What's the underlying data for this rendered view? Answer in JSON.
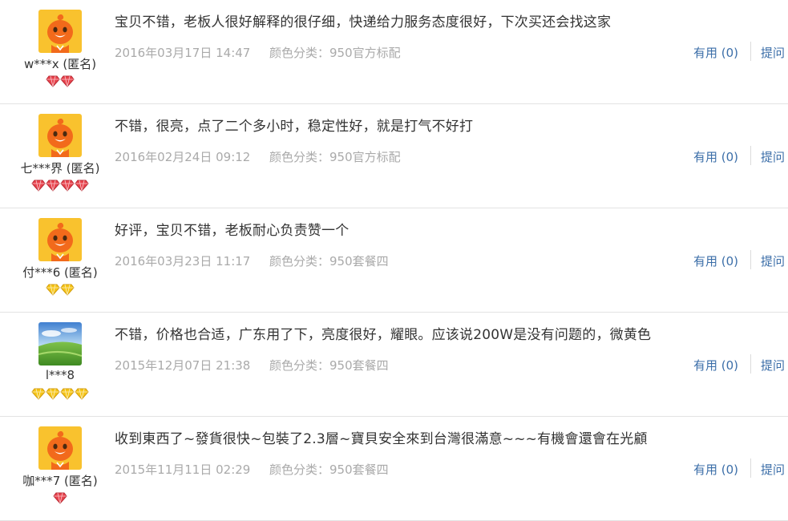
{
  "reviews": [
    {
      "nickname": "w***x (匿名)",
      "avatar": "mascot-icon",
      "badge_type": "red-diamond",
      "badge_count": 2,
      "content": "宝贝不错，老板人很好解释的很仔细，快递给力服务态度很好，下次买还会找这家",
      "date": "2016年03月17日 14:47",
      "sku": "颜色分类：950官方标配",
      "useful": "有用 (0)",
      "reply": "提问"
    },
    {
      "nickname": "七***界 (匿名)",
      "avatar": "mascot-icon",
      "badge_type": "red-diamond",
      "badge_count": 4,
      "content": "不错，很亮，点了二个多小时，稳定性好，就是打气不好打",
      "date": "2016年02月24日 09:12",
      "sku": "颜色分类：950官方标配",
      "useful": "有用 (0)",
      "reply": "提问"
    },
    {
      "nickname": "付***6 (匿名)",
      "avatar": "mascot-icon",
      "badge_type": "yellow-diamond",
      "badge_count": 2,
      "content": "好评，宝贝不错，老板耐心负责赞一个",
      "date": "2016年03月23日 11:17",
      "sku": "颜色分类：950套餐四",
      "useful": "有用 (0)",
      "reply": "提问"
    },
    {
      "nickname": "l***8",
      "avatar": "landscape-photo",
      "badge_type": "yellow-diamond",
      "badge_count": 4,
      "content": "不错，价格也合适，广东用了下，亮度很好，耀眼。应该说200W是没有问题的，微黄色",
      "date": "2015年12月07日 21:38",
      "sku": "颜色分类：950套餐四",
      "useful": "有用 (0)",
      "reply": "提问"
    },
    {
      "nickname": "咖***7 (匿名)",
      "avatar": "mascot-icon",
      "badge_type": "red-diamond",
      "badge_count": 1,
      "content": "收到東西了~發貨很快~包裝了2.3層~寶貝安全來到台灣很滿意~~~有機會還會在光顧",
      "date": "2015年11月11日 02:29",
      "sku": "颜色分类：950套餐四",
      "useful": "有用 (0)",
      "reply": "提问"
    }
  ],
  "colors": {
    "link": "#3b6ea8",
    "meta": "#aaaaaa",
    "text": "#333333",
    "red_badge": "#e8434d",
    "yellow_badge": "#f5c518",
    "mascot_bg": "#f7b733",
    "mascot_body": "#f26a1b"
  }
}
